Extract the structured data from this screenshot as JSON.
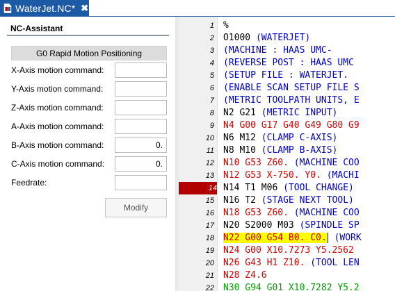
{
  "tab": {
    "title": "WaterJet.NC",
    "modified_marker": "*",
    "close": "✖"
  },
  "panel": {
    "header": "NC-Assistant",
    "title_button": "G0 Rapid Motion Positioning",
    "fields": [
      {
        "label": "X-Axis motion command:",
        "value": ""
      },
      {
        "label": "Y-Axis motion command:",
        "value": ""
      },
      {
        "label": "Z-Axis motion command:",
        "value": ""
      },
      {
        "label": "A-Axis motion command:",
        "value": ""
      },
      {
        "label": "B-Axis motion command:",
        "value": "0."
      },
      {
        "label": "C-Axis motion command:",
        "value": "0."
      },
      {
        "label": "Feedrate:",
        "value": ""
      }
    ],
    "modify_button": "Modify"
  },
  "editor": {
    "colors": {
      "black": "#000000",
      "blue": "#0000c8",
      "red": "#d40000",
      "green": "#00a000",
      "breakpoint": "#b20000",
      "highlight": "#ffff00"
    },
    "lines": [
      {
        "num": "1",
        "segments": [
          {
            "text": "%",
            "color": "black"
          }
        ]
      },
      {
        "num": "2",
        "segments": [
          {
            "text": "O1000 ",
            "color": "black"
          },
          {
            "text": "(WATERJET)",
            "color": "blue"
          }
        ]
      },
      {
        "num": "3",
        "segments": [
          {
            "text": "(MACHINE      : HAAS UMC-",
            "color": "blue"
          }
        ]
      },
      {
        "num": "4",
        "segments": [
          {
            "text": "(REVERSE POST : HAAS UMC",
            "color": "blue"
          }
        ]
      },
      {
        "num": "5",
        "segments": [
          {
            "text": "(SETUP FILE   : WATERJET.",
            "color": "blue"
          }
        ]
      },
      {
        "num": "6",
        "segments": [
          {
            "text": "(ENABLE SCAN SETUP FILE S",
            "color": "blue"
          }
        ]
      },
      {
        "num": "7",
        "segments": [
          {
            "text": "(METRIC TOOLPATH UNITS, E",
            "color": "blue"
          }
        ]
      },
      {
        "num": "8",
        "segments": [
          {
            "text": "N2 G21 ",
            "color": "black"
          },
          {
            "text": "(METRIC INPUT)",
            "color": "blue"
          }
        ]
      },
      {
        "num": "9",
        "segments": [
          {
            "text": "N4 G00 G17 G40 G49 G80 G9",
            "color": "red"
          }
        ]
      },
      {
        "num": "10",
        "segments": [
          {
            "text": "N6 M12 ",
            "color": "black"
          },
          {
            "text": "(CLAMP C-AXIS)",
            "color": "blue"
          }
        ]
      },
      {
        "num": "11",
        "segments": [
          {
            "text": "N8 M10 ",
            "color": "black"
          },
          {
            "text": "(CLAMP B-AXIS)",
            "color": "blue"
          }
        ]
      },
      {
        "num": "12",
        "segments": [
          {
            "text": "N10 G53 Z60. ",
            "color": "red"
          },
          {
            "text": "(MACHINE COO",
            "color": "blue"
          }
        ]
      },
      {
        "num": "13",
        "segments": [
          {
            "text": "N12 G53 X-750. Y0. ",
            "color": "red"
          },
          {
            "text": "(MACHI",
            "color": "blue"
          }
        ]
      },
      {
        "num": "14",
        "breakpoint": true,
        "segments": [
          {
            "text": "N14 T1 M06 ",
            "color": "black"
          },
          {
            "text": "(TOOL CHANGE)",
            "color": "blue"
          }
        ]
      },
      {
        "num": "15",
        "segments": [
          {
            "text": "N16 T2 ",
            "color": "black"
          },
          {
            "text": "(STAGE NEXT TOOL)",
            "color": "blue"
          }
        ]
      },
      {
        "num": "16",
        "segments": [
          {
            "text": "N18 G53 Z60. ",
            "color": "red"
          },
          {
            "text": "(MACHINE COO",
            "color": "blue"
          }
        ]
      },
      {
        "num": "17",
        "segments": [
          {
            "text": "N20 S2000 M03 ",
            "color": "black"
          },
          {
            "text": "(SPINDLE SP",
            "color": "blue"
          }
        ]
      },
      {
        "num": "18",
        "segments": [
          {
            "text": "N22 G00 G54 B0. C0.",
            "color": "red",
            "highlight": true,
            "cursor": true
          },
          {
            "text": " (WORK",
            "color": "blue"
          }
        ]
      },
      {
        "num": "19",
        "segments": [
          {
            "text": "N24 G00 X10.7273 Y5.2562",
            "color": "red"
          }
        ]
      },
      {
        "num": "20",
        "segments": [
          {
            "text": "N26 G43 H1 Z10. ",
            "color": "red"
          },
          {
            "text": "(TOOL LEN",
            "color": "blue"
          }
        ]
      },
      {
        "num": "21",
        "segments": [
          {
            "text": "N28 Z4.6",
            "color": "red"
          }
        ]
      },
      {
        "num": "22",
        "segments": [
          {
            "text": "N30 G94 G01 X10.7282 Y5.2",
            "color": "green"
          }
        ]
      }
    ]
  }
}
